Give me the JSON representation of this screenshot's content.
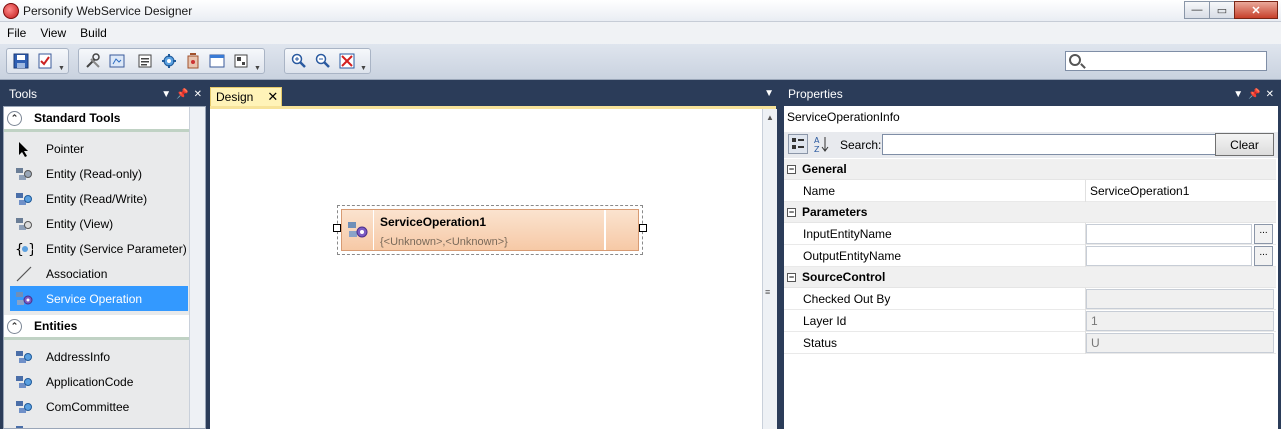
{
  "window": {
    "title": "Personify WebService Designer",
    "minimize": "—",
    "maximize": "▭",
    "close": "✕"
  },
  "menu": [
    "File",
    "View",
    "Build"
  ],
  "toolbar": {
    "icons": [
      "save-icon",
      "validate-icon",
      "tools-icon",
      "preview-icon",
      "properties-icon",
      "entity-icon",
      "delete-icon",
      "window-icon",
      "layout-icon",
      "zoom-in-icon",
      "zoom-out-icon",
      "zoom-reset-icon"
    ],
    "search_placeholder": ""
  },
  "tools_panel": {
    "title": "Tools",
    "categories": [
      {
        "name": "Standard Tools",
        "items": [
          {
            "label": "Pointer",
            "icon": "pointer-icon"
          },
          {
            "label": "Entity (Read-only)",
            "icon": "entity-readonly-icon"
          },
          {
            "label": "Entity (Read/Write)",
            "icon": "entity-readwrite-icon"
          },
          {
            "label": "Entity (View)",
            "icon": "entity-view-icon"
          },
          {
            "label": "Entity (Service Parameter)",
            "icon": "entity-parameter-icon"
          },
          {
            "label": "Association",
            "icon": "association-icon"
          },
          {
            "label": "Service Operation",
            "icon": "service-operation-icon",
            "selected": true
          }
        ]
      },
      {
        "name": "Entities",
        "items": [
          {
            "label": "AddressInfo",
            "icon": "entity-icon"
          },
          {
            "label": "ApplicationCode",
            "icon": "entity-icon"
          },
          {
            "label": "ComCommittee",
            "icon": "entity-icon"
          },
          {
            "label": "",
            "icon": "entity-icon"
          }
        ]
      }
    ]
  },
  "design": {
    "tab_label": "Design",
    "node": {
      "title": "ServiceOperation1",
      "subtitle": "{<Unknown>,<Unknown>}"
    }
  },
  "properties": {
    "title": "Properties",
    "object_name": "ServiceOperationInfo",
    "search_label": "Search:",
    "search_value": "",
    "clear_label": "Clear",
    "categories": [
      {
        "name": "General",
        "rows": [
          {
            "name": "Name",
            "value": "ServiceOperation1",
            "style": "plain"
          }
        ]
      },
      {
        "name": "Parameters",
        "rows": [
          {
            "name": "InputEntityName",
            "value": "",
            "style": "boxed"
          },
          {
            "name": "OutputEntityName",
            "value": "",
            "style": "boxed"
          }
        ]
      },
      {
        "name": "SourceControl",
        "rows": [
          {
            "name": "Checked Out By",
            "value": "",
            "style": "ro"
          },
          {
            "name": "Layer Id",
            "value": "1",
            "style": "ro"
          },
          {
            "name": "Status",
            "value": "U",
            "style": "ro"
          }
        ]
      }
    ]
  }
}
